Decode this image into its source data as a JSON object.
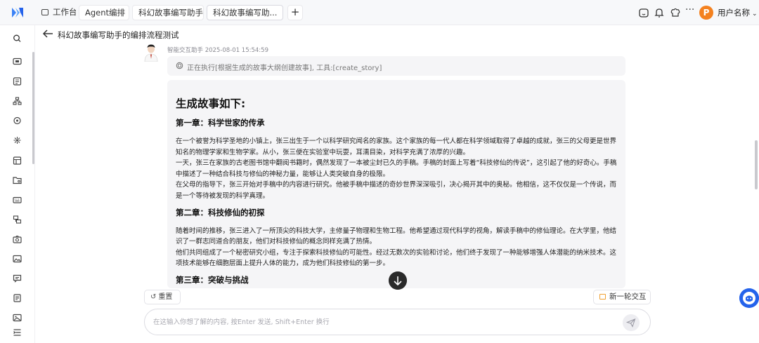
{
  "topbar": {
    "tabs": [
      {
        "label": "工作台",
        "icon": "monitor-icon"
      },
      {
        "label": "Agent编排"
      },
      {
        "label": "科幻故事编写助手"
      },
      {
        "label": "科幻故事编写助..."
      }
    ],
    "add_tab": "+",
    "more": "···",
    "avatar_letter": "P",
    "username": "用户名称"
  },
  "header": {
    "title": "科幻故事编写助手的编排流程测试"
  },
  "message": {
    "meta": "智能交互助手 2025-08-01 15:54:59",
    "status": "正在执行[根据生成的故事大纲创建故事], 工具:[create_story]",
    "story_title": "生成故事如下:",
    "chapters": [
      {
        "title": "第一章：科学世家的传承",
        "paras": [
          "在一个被誉为科学圣地的小镇上，张三出生于一个以科学研究闻名的家族。这个家族的每一代人都在科学领域取得了卓越的成就，张三的父母更是世界知名的物理学家和生物学家。从小，张三便在实验室中玩耍，耳濡目染，对科学充满了浓厚的兴趣。",
          "一天，张三在家族的古老图书馆中翻阅书籍时，偶然发现了一本被尘封已久的手稿。手稿的封面上写着“科技修仙的传说”，这引起了他的好奇心。手稿中描述了一种结合科技与修仙的神秘力量，能够让人类突破自身的极限。",
          "在父母的指导下，张三开始对手稿中的内容进行研究。他被手稿中描述的奇妙世界深深吸引，决心揭开其中的奥秘。他相信，这不仅仅是一个传说，而是一个等待被发现的科学真理。"
        ]
      },
      {
        "title": "第二章：科技修仙的初探",
        "paras": [
          "随着时间的推移，张三进入了一所顶尖的科技大学，主修量子物理和生物工程。他希望通过现代科学的视角，解读手稿中的修仙理论。在大学里，他结识了一群志同道合的朋友，他们对科技修仙的概念同样充满了热情。",
          "他们共同组成了一个秘密研究小组，专注于探索科技修仙的可能性。经过无数次的实验和讨论，他们终于发现了一种能够增强人体潜能的纳米技术。这项技术能够在细胞层面上提升人体的能力，成为他们科技修仙的第一步。"
        ]
      },
      {
        "title": "第三章：突破与挑战",
        "paras": []
      }
    ]
  },
  "controls": {
    "reset_label": "重置",
    "new_session_label": "新一轮交互",
    "input_placeholder": "在这输入你想了解的内容, 按Enter 发送, Shift+Enter 换行"
  },
  "colors": {
    "accent_blue": "#2563eb",
    "avatar_orange": "#f4811f"
  }
}
